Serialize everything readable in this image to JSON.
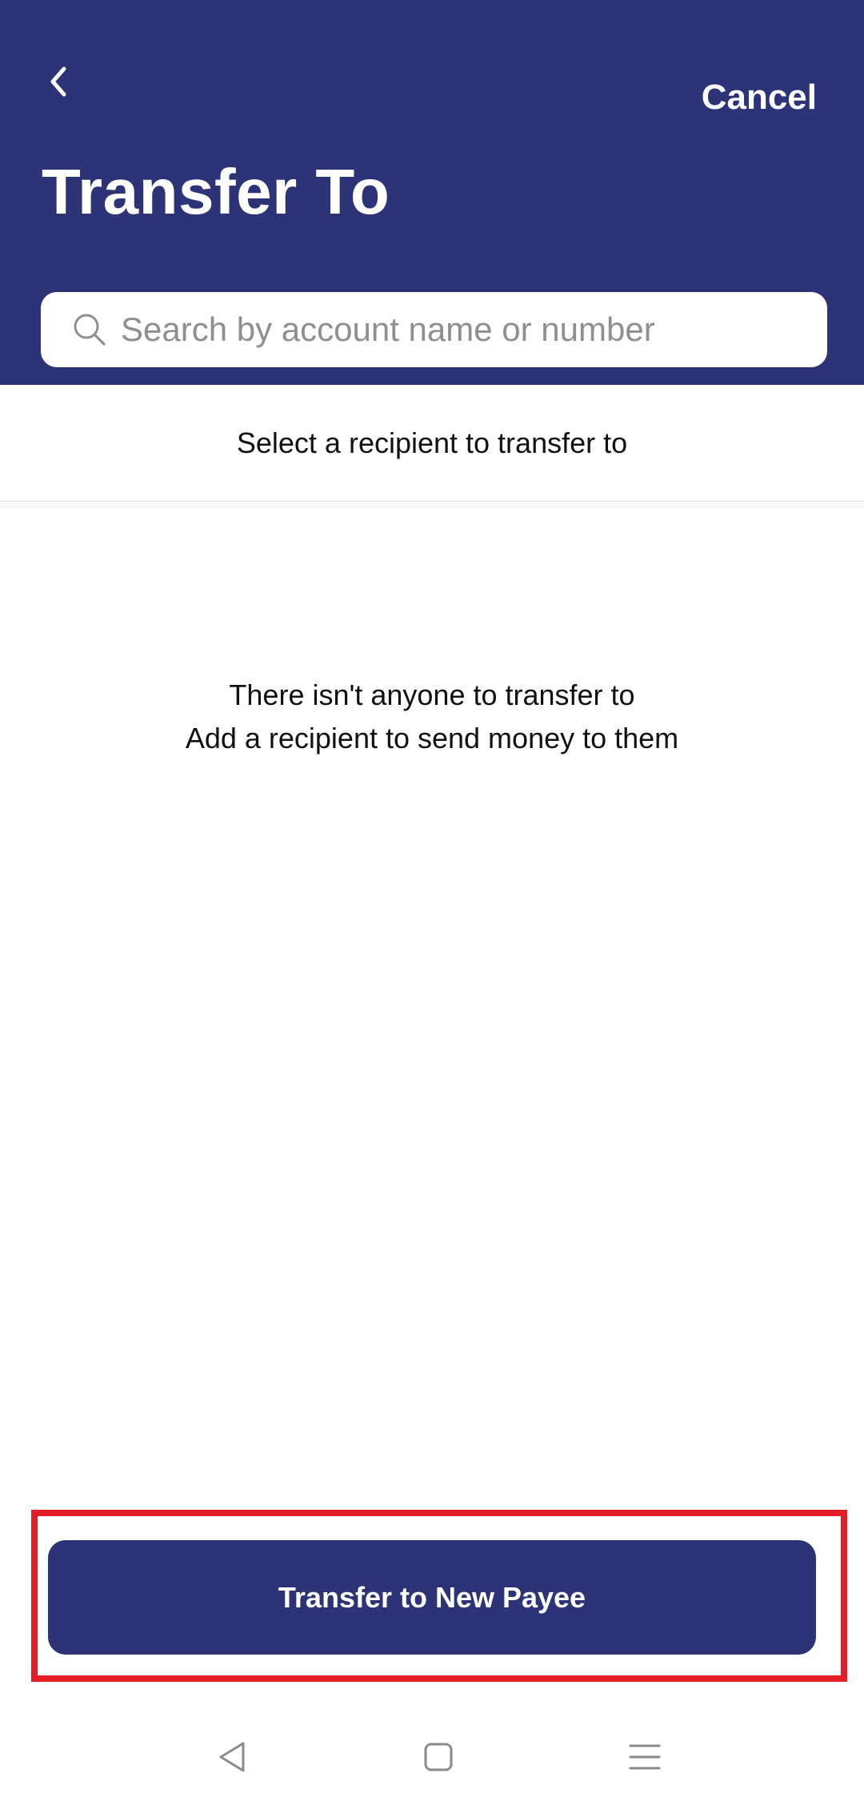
{
  "header": {
    "title": "Transfer To",
    "cancel_label": "Cancel",
    "back_icon": "chevron-left-icon",
    "background_color": "#2c3376"
  },
  "search": {
    "placeholder": "Search by account name or number",
    "value": "",
    "icon": "search-icon"
  },
  "subheader": {
    "text": "Select a recipient to transfer to"
  },
  "empty_state": {
    "line1": "There isn't anyone to transfer to",
    "line2": "Add a recipient to send money to them"
  },
  "actions": {
    "primary_label": "Transfer to New Payee",
    "primary_color": "#2c3376",
    "highlight_color": "#e41e26"
  },
  "system_nav": {
    "back_icon": "triangle-back-icon",
    "home_icon": "square-home-icon",
    "menu_icon": "hamburger-menu-icon"
  }
}
